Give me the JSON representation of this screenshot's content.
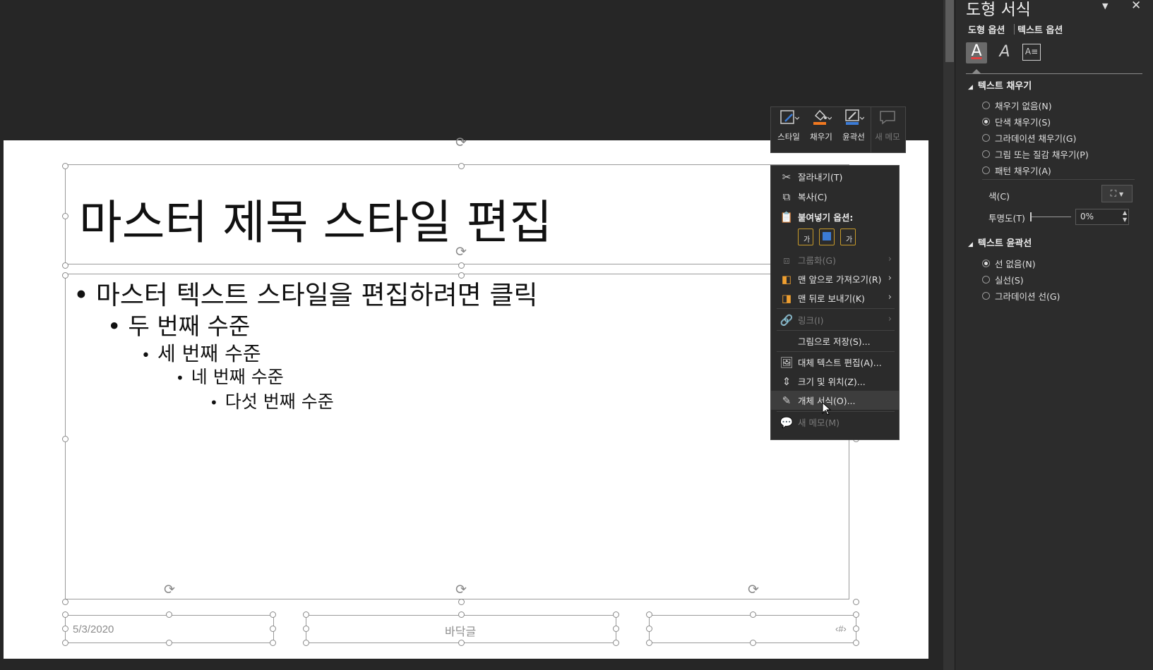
{
  "slide": {
    "title": "마스터 제목 스타일 편집",
    "bullets": [
      {
        "text": "마스터 텍스트 스타일을 편집하려면 클릭",
        "level": 1
      },
      {
        "text": "두 번째 수준",
        "level": 2
      },
      {
        "text": "세 번째 수준",
        "level": 3
      },
      {
        "text": "네 번째 수준",
        "level": 4
      },
      {
        "text": "다섯 번째 수준",
        "level": 5
      }
    ],
    "footer": {
      "date": "5/3/2020",
      "center": "바닥글",
      "page": "‹#›"
    }
  },
  "mini_toolbar": {
    "style_label": "스타일",
    "fill_label": "채우기",
    "outline_label": "윤곽선",
    "new_comment_label": "새 메모",
    "fill_color": "#f07820",
    "outline_color": "#3b7bd6"
  },
  "context_menu": {
    "cut": "잘라내기(T)",
    "copy": "복사(C)",
    "paste_options": "붙여넣기 옵션:",
    "paste_glyph": "가",
    "group": "그룹화(G)",
    "bring_front": "맨 앞으로 가져오기(R)",
    "send_back": "맨 뒤로 보내기(K)",
    "link": "링크(I)",
    "save_picture": "그림으로 저장(S)...",
    "alt_text": "대체 텍스트 편집(A)...",
    "size_position": "크기 및 위치(Z)...",
    "format_object": "개체 서식(O)...",
    "new_comment": "새 메모(M)"
  },
  "pane": {
    "title": "도형 서식",
    "tabs": [
      "도형 옵션",
      "텍스트 옵션"
    ],
    "text_fill": {
      "header": "텍스트 채우기",
      "options": [
        "채우기 없음(N)",
        "단색 채우기(S)",
        "그라데이션 채우기(G)",
        "그림 또는 질감 채우기(P)",
        "패턴 채우기(A)"
      ],
      "selected": 1,
      "color_label": "색(C)",
      "transparency_label": "투명도(T)",
      "transparency_value": "0%"
    },
    "text_outline": {
      "header": "텍스트 윤곽선",
      "options": [
        "선 없음(N)",
        "실선(S)",
        "그라데이션 선(G)"
      ],
      "selected": 0
    }
  }
}
